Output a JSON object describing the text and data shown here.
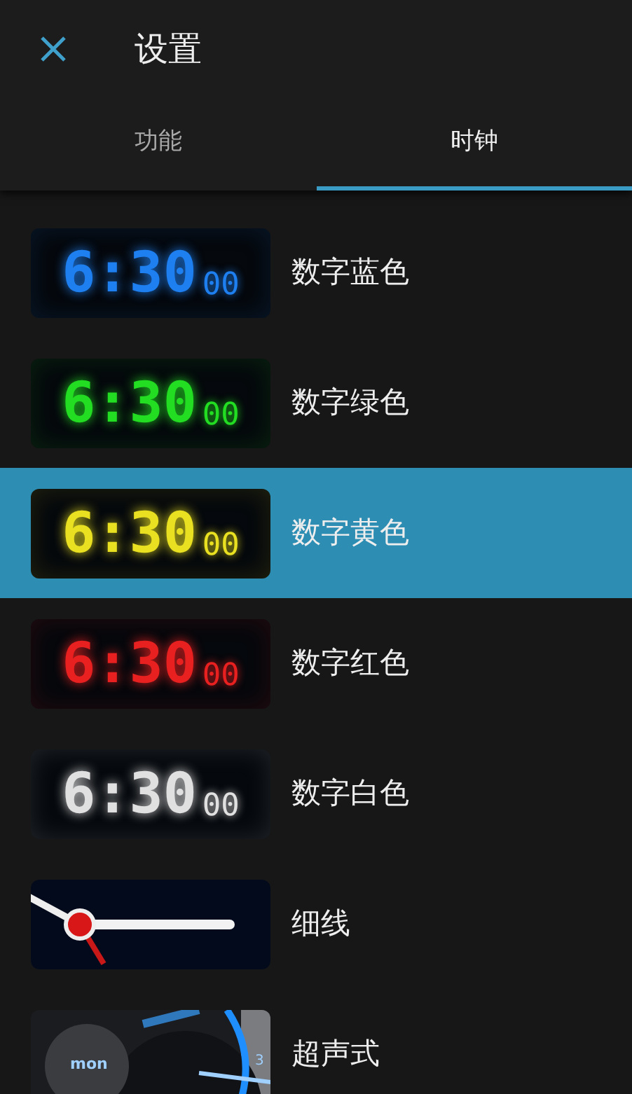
{
  "header": {
    "title": "设置"
  },
  "tabs": [
    {
      "label": "功能",
      "selected": false
    },
    {
      "label": "时钟",
      "selected": true
    }
  ],
  "items": [
    {
      "label": "数字蓝色",
      "selected": false,
      "preview": {
        "kind": "digital",
        "color": "#1e7ff0",
        "time": "6:30",
        "seconds": "00"
      }
    },
    {
      "label": "数字绿色",
      "selected": false,
      "preview": {
        "kind": "digital",
        "color": "#22dd22",
        "time": "6:30",
        "seconds": "00"
      }
    },
    {
      "label": "数字黄色",
      "selected": true,
      "preview": {
        "kind": "digital",
        "color": "#e8e020",
        "time": "6:30",
        "seconds": "00"
      }
    },
    {
      "label": "数字红色",
      "selected": false,
      "preview": {
        "kind": "digital",
        "color": "#e82020",
        "time": "6:30",
        "seconds": "00"
      }
    },
    {
      "label": "数字白色",
      "selected": false,
      "preview": {
        "kind": "digital",
        "color": "#e0e0e0",
        "time": "6:30",
        "seconds": "00"
      }
    },
    {
      "label": "细线",
      "selected": false,
      "preview": {
        "kind": "analog"
      }
    },
    {
      "label": "超声式",
      "selected": false,
      "preview": {
        "kind": "gauge",
        "day": "mon",
        "number": "3"
      }
    }
  ]
}
